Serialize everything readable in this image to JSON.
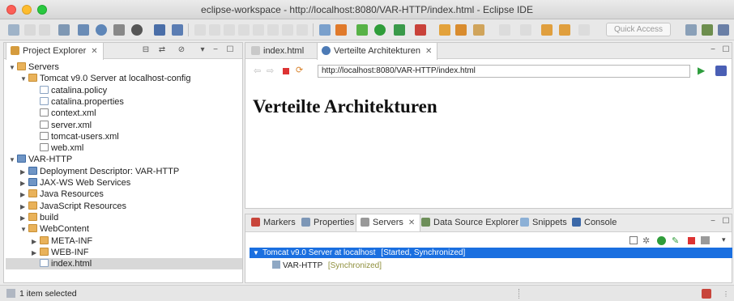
{
  "window": {
    "title": "eclipse-workspace - http://localhost:8080/VAR-HTTP/index.html - Eclipse IDE"
  },
  "toolbar": {
    "quick_access": "Quick Access"
  },
  "project_explorer": {
    "tab_label": "Project Explorer",
    "tree": [
      {
        "label": "Servers",
        "depth": 0,
        "icon": "folder-icon",
        "expanded": true
      },
      {
        "label": "Tomcat v9.0 Server at localhost-config",
        "depth": 1,
        "icon": "folder-icon",
        "expanded": true
      },
      {
        "label": "catalina.policy",
        "depth": 2,
        "icon": "file-icon"
      },
      {
        "label": "catalina.properties",
        "depth": 2,
        "icon": "file-icon"
      },
      {
        "label": "context.xml",
        "depth": 2,
        "icon": "xml-file-icon"
      },
      {
        "label": "server.xml",
        "depth": 2,
        "icon": "xml-file-icon"
      },
      {
        "label": "tomcat-users.xml",
        "depth": 2,
        "icon": "xml-file-icon"
      },
      {
        "label": "web.xml",
        "depth": 2,
        "icon": "xml-file-icon"
      },
      {
        "label": "VAR-HTTP",
        "depth": 0,
        "icon": "project-icon",
        "expanded": true
      },
      {
        "label": "Deployment Descriptor: VAR-HTTP",
        "depth": 1,
        "icon": "descriptor-icon",
        "expanded": false
      },
      {
        "label": "JAX-WS Web Services",
        "depth": 1,
        "icon": "webservice-icon",
        "expanded": false
      },
      {
        "label": "Java Resources",
        "depth": 1,
        "icon": "java-resources-icon",
        "expanded": false
      },
      {
        "label": "JavaScript Resources",
        "depth": 1,
        "icon": "javascript-resources-icon",
        "expanded": false
      },
      {
        "label": "build",
        "depth": 1,
        "icon": "folder-icon",
        "expanded": false
      },
      {
        "label": "WebContent",
        "depth": 1,
        "icon": "folder-icon",
        "expanded": true
      },
      {
        "label": "META-INF",
        "depth": 2,
        "icon": "folder-icon",
        "expanded": false
      },
      {
        "label": "WEB-INF",
        "depth": 2,
        "icon": "folder-icon",
        "expanded": false
      },
      {
        "label": "index.html",
        "depth": 2,
        "icon": "html-file-icon",
        "selected": true
      }
    ]
  },
  "editor": {
    "tabs": [
      {
        "label": "index.html",
        "active": false
      },
      {
        "label": "Verteilte Architekturen",
        "active": true
      }
    ],
    "url": "http://localhost:8080/VAR-HTTP/index.html",
    "page_heading": "Verteilte Architekturen"
  },
  "bottom_panel": {
    "tabs": [
      {
        "label": "Markers"
      },
      {
        "label": "Properties"
      },
      {
        "label": "Servers",
        "active": true
      },
      {
        "label": "Data Source Explorer"
      },
      {
        "label": "Snippets"
      },
      {
        "label": "Console"
      }
    ],
    "server": {
      "name": "Tomcat v9.0 Server at localhost",
      "status": "[Started, Synchronized]"
    },
    "module": {
      "name": "VAR-HTTP",
      "status": "[Synchronized]"
    }
  },
  "statusbar": {
    "text": "1 item selected"
  },
  "colors": {
    "selection": "#1a6fe0",
    "status_olive": "#8f8f3c"
  }
}
